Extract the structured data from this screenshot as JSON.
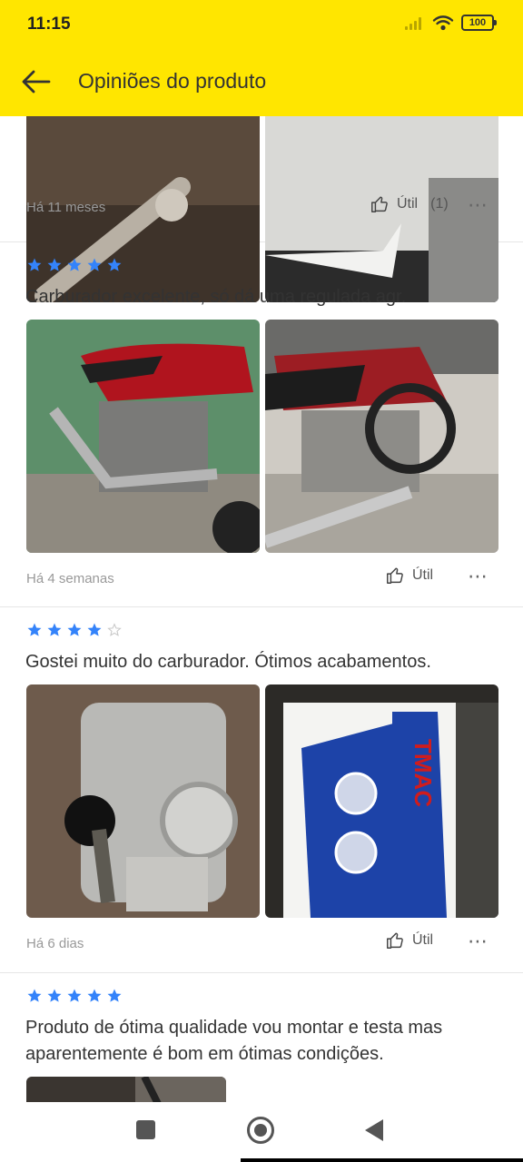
{
  "status_bar": {
    "time": "11:15",
    "battery": "100"
  },
  "header": {
    "title": "Opiniões do produto"
  },
  "colors": {
    "header_bg": "#ffe600",
    "star_filled": "#3483fa",
    "star_empty": "#c8c8c8"
  },
  "reviews": [
    {
      "date": "Há 11 meses",
      "useful_label": "Útil",
      "useful_count": "(1)",
      "more_label": "⋯"
    },
    {
      "rating": 5,
      "text": "Carburador excelente, só dá uma regulada agr.",
      "date": "Há 4 semanas",
      "useful_label": "Útil",
      "more_label": "⋯"
    },
    {
      "rating": 4,
      "text": "Gostei muito do carburador. Ótimos acabamentos.",
      "date": "Há 6 dias",
      "useful_label": "Útil",
      "more_label": "⋯"
    },
    {
      "rating": 5,
      "text": "Produto de ótima qualidade vou montar e testa mas aparentemente é bom em ótimas condições."
    }
  ],
  "nav_bar": {
    "icons": [
      "recents-icon",
      "home-icon",
      "back-icon"
    ]
  }
}
